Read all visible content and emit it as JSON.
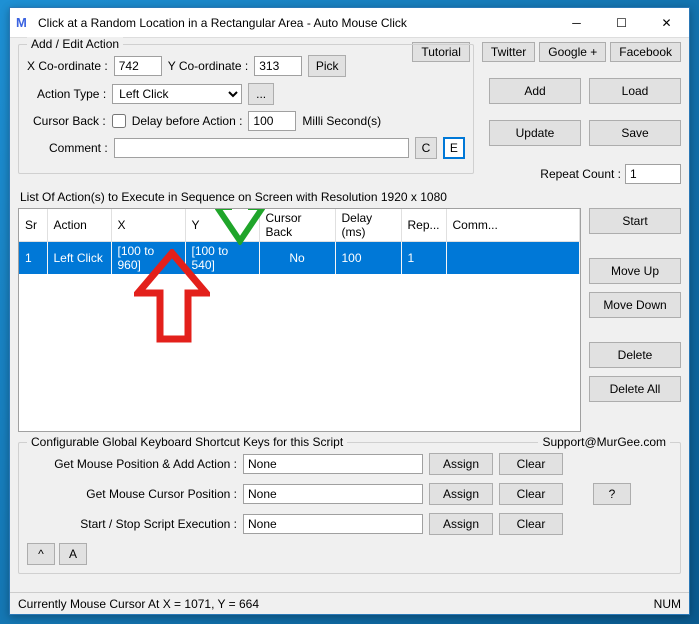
{
  "window": {
    "title": "Click at a Random Location in a Rectangular Area - Auto Mouse Click",
    "logo": "M"
  },
  "toplinks": {
    "tutorial": "Tutorial",
    "twitter": "Twitter",
    "google": "Google +",
    "facebook": "Facebook"
  },
  "group": {
    "legend": "Add / Edit Action",
    "xlabel": "X Co-ordinate :",
    "xval": "742",
    "ylabel": "Y Co-ordinate :",
    "yval": "313",
    "pick": "Pick",
    "actiontype_label": "Action Type :",
    "actiontype_val": "Left Click",
    "dots": "...",
    "cursorback_label": "Cursor Back :",
    "delay_label": "Delay before Action :",
    "delay_val": "100",
    "delay_unit": "Milli Second(s)",
    "comment_label": "Comment :",
    "comment_val": "",
    "c_btn": "C",
    "e_btn": "E",
    "repeat_label": "Repeat Count :",
    "repeat_val": "1"
  },
  "mainbtns": {
    "add": "Add",
    "load": "Load",
    "update": "Update",
    "save": "Save"
  },
  "listlabel": "List Of Action(s) to Execute in Sequence on Screen with Resolution 1920 x 1080",
  "headers": [
    "Sr",
    "Action",
    "X",
    "Y",
    "Cursor Back",
    "Delay (ms)",
    "Rep...",
    "Comm..."
  ],
  "row": [
    "1",
    "Left Click",
    "[100 to 960]",
    "[100 to 540]",
    "No",
    "100",
    "1",
    ""
  ],
  "sidebtns": {
    "start": "Start",
    "moveup": "Move Up",
    "movedown": "Move Down",
    "delete": "Delete",
    "deleteall": "Delete All"
  },
  "shortcuts": {
    "legend": "Configurable Global Keyboard Shortcut Keys for this Script",
    "support": "Support@MurGee.com",
    "row1_label": "Get Mouse Position & Add Action :",
    "row1_val": "None",
    "row2_label": "Get Mouse Cursor Position :",
    "row2_val": "None",
    "row3_label": "Start / Stop Script Execution :",
    "row3_val": "None",
    "assign": "Assign",
    "clear": "Clear",
    "help": "?"
  },
  "bottomsmall": {
    "caret": "^",
    "a": "A"
  },
  "status": {
    "text": "Currently Mouse Cursor At X = 1071, Y = 664",
    "num": "NUM"
  }
}
